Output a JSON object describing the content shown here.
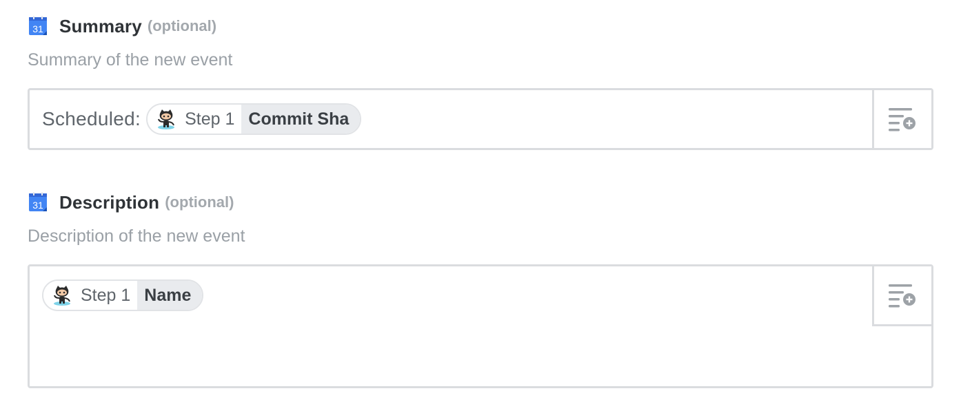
{
  "fields": {
    "summary": {
      "icon": "google-calendar-icon",
      "title": "Summary",
      "optional_label": "(optional)",
      "help": "Summary of the new event",
      "value_prefix": "Scheduled:",
      "token": {
        "icon": "github-octocat-icon",
        "step": "Step 1",
        "field": "Commit Sha"
      }
    },
    "description": {
      "icon": "google-calendar-icon",
      "title": "Description",
      "optional_label": "(optional)",
      "help": "Description of the new event",
      "token": {
        "icon": "github-octocat-icon",
        "step": "Step 1",
        "field": "Name"
      }
    }
  },
  "calendar_icon_text": "31",
  "insert_button_icon": "insert-data-icon",
  "colors": {
    "calendar_blue": "#4285f4",
    "border": "#dadcdf",
    "muted_text": "#9aa0a6",
    "pill_right_bg": "#e9ebee"
  }
}
